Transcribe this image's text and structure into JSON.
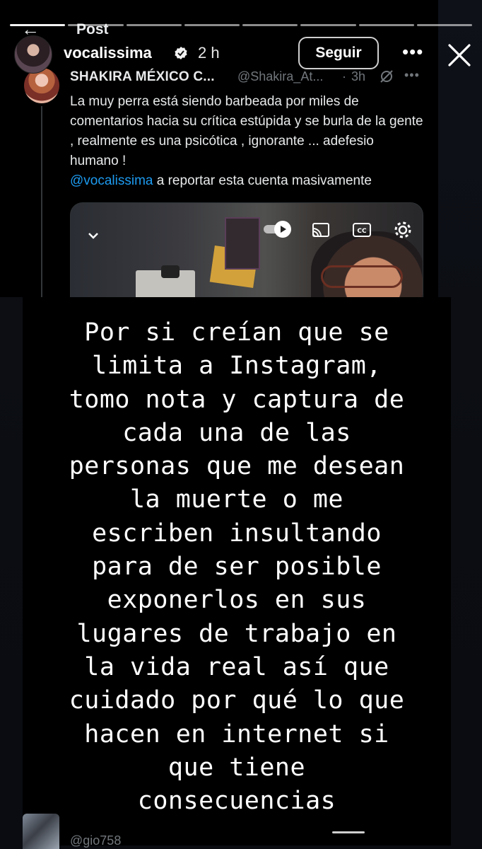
{
  "story": {
    "username": "vocalissima",
    "time_ago": "2 h",
    "follow_label": "Seguir",
    "more_icon": "more-horizontal-icon",
    "close_icon": "close-icon",
    "progress_segments": 8,
    "progress_current": 1
  },
  "tweet": {
    "header_label": "Post",
    "author_name": "SHAKIRA MÉXICO C...",
    "author_handle": "@Shakira_At...",
    "separator": "·",
    "time": "3h",
    "text": "La muy perra está siendo barbeada por miles de comentarios hacia su crítica estúpida y se burla de la gente , realmente es una psicótica , ignorante ... adefesio humano !",
    "mention": "@vocalissima",
    "mention_rest": " a reportar esta cuenta masivamente"
  },
  "overlay": {
    "text": "Por si creían que se\nlimita a Instagram,\ntomo nota y captura de\ncada una de las\npersonas que me desean\nla muerte o me\nescriben insultando\npara de ser posible\nexponerlos en sus\nlugares de trabajo en\nla vida real así que\ncuidado por qué lo que\nhacen en internet si\nque tiene\nconsecuencias"
  },
  "comment": {
    "handle": "@gio758"
  },
  "colors": {
    "x_link_blue": "#1d9bf0",
    "x_muted": "#71767b",
    "background": "#0c0f15"
  }
}
